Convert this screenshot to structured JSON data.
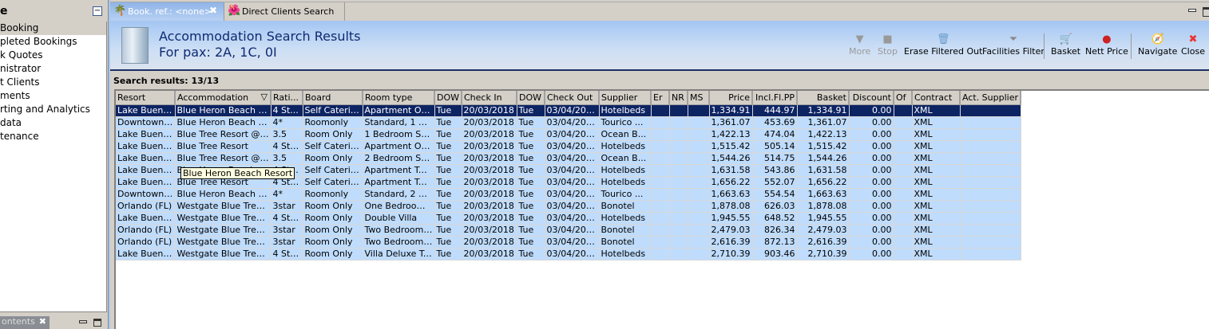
{
  "left_panel": {
    "title": "e",
    "items": [
      {
        "label": "Booking"
      },
      {
        "label": "pleted Bookings"
      },
      {
        "label": "k Quotes"
      },
      {
        "label": "nistrator"
      },
      {
        "label": "t Clients"
      },
      {
        "label": "ments"
      },
      {
        "label": "rting and Analytics"
      },
      {
        "label": "data"
      },
      {
        "label": "tenance"
      }
    ],
    "bottom_tab": "ontents"
  },
  "tabs": [
    {
      "label": "Book. ref.: <none>",
      "icon": "palm-tree-icon"
    },
    {
      "label": "Direct Clients Search",
      "icon": "flower-icon"
    }
  ],
  "banner": {
    "title": "Accommodation Search Results",
    "subtitle": "For pax: 2A, 1C, 0I"
  },
  "toolbar": {
    "more": "More",
    "stop": "Stop",
    "erase": "Erase Filtered Out",
    "facilities": "Facilities Filter",
    "basket": "Basket",
    "nett": "Nett Price",
    "navigate": "Navigate",
    "close": "Close"
  },
  "search_results": "Search results: 13/13",
  "tooltip": "Blue Heron Beach Resort",
  "columns": [
    "Resort",
    "Accommodation",
    "Rati...",
    "Board",
    "Room type",
    "DOW",
    "Check In",
    "DOW",
    "Check Out",
    "Supplier",
    "Er",
    "NR",
    "MS",
    "Price",
    "Incl.Fl.PP",
    "Basket",
    "Discount",
    "Of",
    "Contract",
    "Act. Supplier"
  ],
  "rows": [
    [
      "Lake Buena...",
      "Blue Heron Beach Re...",
      "4 St...",
      "Self Catering",
      "Apartment On...",
      "Tue",
      "20/03/2018",
      "Tue",
      "03/04/2018",
      "Hotelbeds",
      "",
      "",
      "",
      "1,334.91",
      "444.97",
      "1,334.91",
      "0.00",
      "",
      "XML",
      ""
    ],
    [
      "Downtown ...",
      "Blue Heron Beach Re...",
      "4*",
      "Roomonly",
      "Standard, 1 Be...",
      "Tue",
      "20/03/2018",
      "Tue",
      "03/04/2018",
      "Tourico ...",
      "",
      "",
      "",
      "1,361.07",
      "453.69",
      "1,361.07",
      "0.00",
      "",
      "XML",
      ""
    ],
    [
      "Lake Buena...",
      "Blue Tree Resort @ LBV",
      "3.5",
      "Room Only",
      "1 Bedroom Suit...",
      "Tue",
      "20/03/2018",
      "Tue",
      "03/04/2018",
      "Ocean B...",
      "",
      "",
      "",
      "1,422.13",
      "474.04",
      "1,422.13",
      "0.00",
      "",
      "XML",
      ""
    ],
    [
      "Lake Buena...",
      "Blue Tree Resort",
      "4 Stars",
      "Self Catering",
      "Apartment On...",
      "Tue",
      "20/03/2018",
      "Tue",
      "03/04/2018",
      "Hotelbeds",
      "",
      "",
      "",
      "1,515.42",
      "505.14",
      "1,515.42",
      "0.00",
      "",
      "XML",
      ""
    ],
    [
      "Lake Buena...",
      "Blue Tree Resort @ LBV",
      "3.5",
      "Room Only",
      "2 Bedroom Suit...",
      "Tue",
      "20/03/2018",
      "Tue",
      "03/04/2018",
      "Ocean B...",
      "",
      "",
      "",
      "1,544.26",
      "514.75",
      "1,544.26",
      "0.00",
      "",
      "XML",
      ""
    ],
    [
      "Lake Buena...",
      "Blue Heron Beach Re...",
      "4 St...",
      "Self Catering",
      "Apartment Tw...",
      "Tue",
      "20/03/2018",
      "Tue",
      "03/04/2018",
      "Hotelbeds",
      "",
      "",
      "",
      "1,631.58",
      "543.86",
      "1,631.58",
      "0.00",
      "",
      "XML",
      ""
    ],
    [
      "Lake Buena...",
      "Blue Tree Resort",
      "4 Stars",
      "Self Catering",
      "Apartment Tw...",
      "Tue",
      "20/03/2018",
      "Tue",
      "03/04/2018",
      "Hotelbeds",
      "",
      "",
      "",
      "1,656.22",
      "552.07",
      "1,656.22",
      "0.00",
      "",
      "XML",
      ""
    ],
    [
      "Downtown ...",
      "Blue Heron Beach Re...",
      "4*",
      "Roomonly",
      "Standard, 2 Be...",
      "Tue",
      "20/03/2018",
      "Tue",
      "03/04/2018",
      "Tourico ...",
      "",
      "",
      "",
      "1,663.63",
      "554.54",
      "1,663.63",
      "0.00",
      "",
      "XML",
      ""
    ],
    [
      "Orlando (FL)",
      "Westgate Blue Tree ...",
      "3star",
      "Room Only",
      "One Bedroom ...",
      "Tue",
      "20/03/2018",
      "Tue",
      "03/04/2018",
      "Bonotel",
      "",
      "",
      "",
      "1,878.08",
      "626.03",
      "1,878.08",
      "0.00",
      "",
      "XML",
      ""
    ],
    [
      "Lake Buena...",
      "Westgate Blue Tree ...",
      "4 Stars",
      "Room Only",
      "Double Villa",
      "Tue",
      "20/03/2018",
      "Tue",
      "03/04/2018",
      "Hotelbeds",
      "",
      "",
      "",
      "1,945.55",
      "648.52",
      "1,945.55",
      "0.00",
      "",
      "XML",
      ""
    ],
    [
      "Orlando (FL)",
      "Westgate Blue Tree ...",
      "3star",
      "Room Only",
      "Two Bedroom ...",
      "Tue",
      "20/03/2018",
      "Tue",
      "03/04/2018",
      "Bonotel",
      "",
      "",
      "",
      "2,479.03",
      "826.34",
      "2,479.03",
      "0.00",
      "",
      "XML",
      ""
    ],
    [
      "Orlando (FL)",
      "Westgate Blue Tree ...",
      "3star",
      "Room Only",
      "Two Bedroom ...",
      "Tue",
      "20/03/2018",
      "Tue",
      "03/04/2018",
      "Bonotel",
      "",
      "",
      "",
      "2,616.39",
      "872.13",
      "2,616.39",
      "0.00",
      "",
      "XML",
      ""
    ],
    [
      "Lake Buena...",
      "Westgate Blue Tree ...",
      "4 Stars",
      "Room Only",
      "Villa Deluxe Tw...",
      "Tue",
      "20/03/2018",
      "Tue",
      "03/04/2018",
      "Hotelbeds",
      "",
      "",
      "",
      "2,710.39",
      "903.46",
      "2,710.39",
      "0.00",
      "",
      "XML",
      ""
    ]
  ],
  "colors": {
    "selected_row": "#0d2463",
    "row_bg": "#bfdcfc",
    "title": "#0f2a72"
  }
}
